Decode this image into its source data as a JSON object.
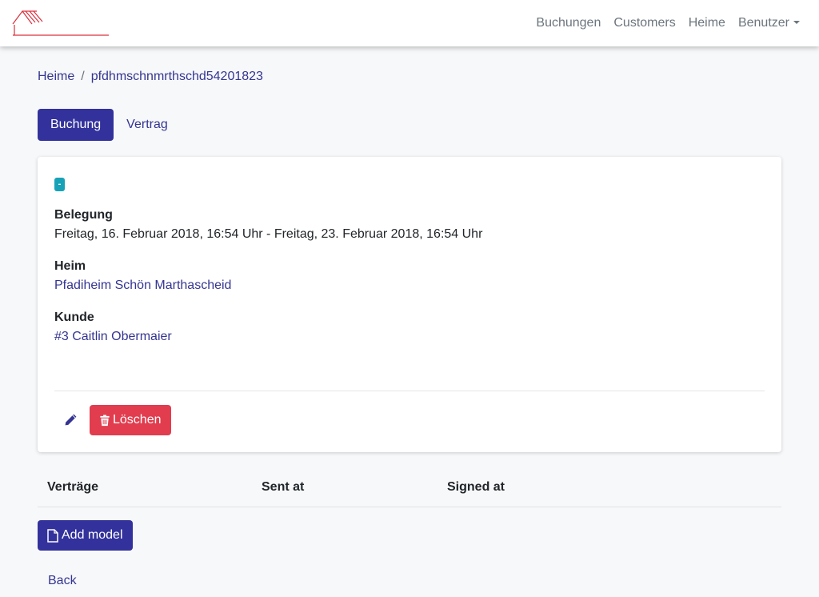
{
  "navbar": {
    "logo_icon": "house-roof-logo",
    "links": [
      "Buchungen",
      "Customers",
      "Heime"
    ],
    "dropdown_label": "Benutzer"
  },
  "breadcrumb": {
    "parent": "Heime",
    "current": "pfdhmschnmrthschd54201823"
  },
  "tabs": {
    "active": "Buchung",
    "inactive": "Vertrag"
  },
  "booking": {
    "status_badge": "-",
    "belegung_label": "Belegung",
    "belegung_value": "Freitag, 16. Februar 2018, 16:54 Uhr - Freitag, 23. Februar 2018, 16:54 Uhr",
    "heim_label": "Heim",
    "heim_value": "Pfadiheim Schön Marthascheid",
    "kunde_label": "Kunde",
    "kunde_value": "#3 Caitlin Obermaier",
    "edit_icon": "pencil-icon",
    "delete_label": "Löschen",
    "delete_icon": "trash-icon"
  },
  "contracts_table": {
    "columns": [
      "Verträge",
      "Sent at",
      "Signed at"
    ],
    "rows": []
  },
  "add_button_label": "Add model",
  "add_button_icon": "file-icon",
  "back_label": "Back",
  "colors": {
    "primary": "#33329c",
    "danger": "#e13d4e",
    "info": "#17a2b8",
    "logo_red": "#d9303c"
  }
}
